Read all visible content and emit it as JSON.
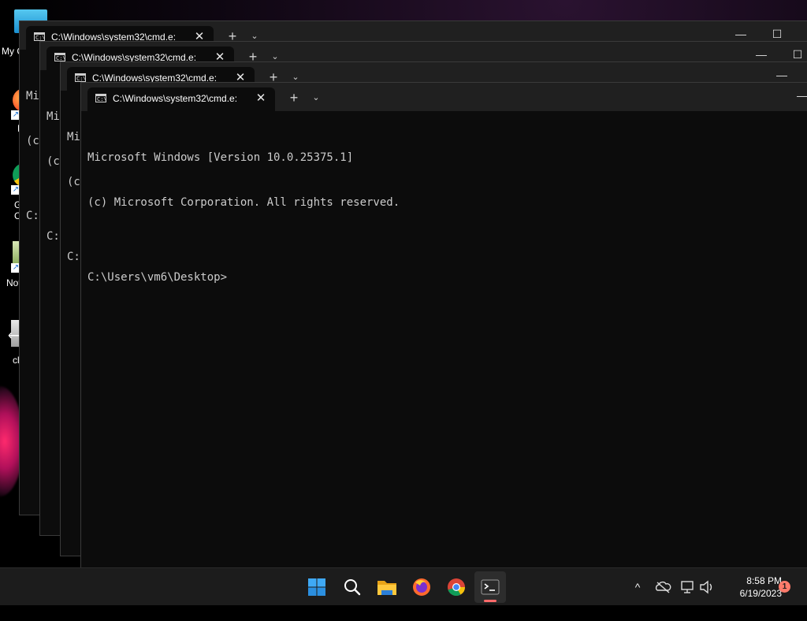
{
  "desktop": {
    "icons": [
      {
        "label": "My C"
      },
      {
        "label": "F"
      },
      {
        "label": "G"
      },
      {
        "label": "C"
      },
      {
        "label": "Not"
      },
      {
        "label": "cl"
      }
    ]
  },
  "windows": {
    "tab_title": "C:\\Windows\\system32\\cmd.e:",
    "close_glyph": "✕",
    "add_glyph": "+",
    "dropdown_glyph": "⌄",
    "minimize_glyph": "—",
    "maximize_glyph": "☐",
    "stub_lines": [
      "Mi",
      "(c",
      "",
      "C:"
    ],
    "active_lines": [
      "Microsoft Windows [Version 10.0.25375.1]",
      "(c) Microsoft Corporation. All rights reserved.",
      "",
      "C:\\Users\\vm6\\Desktop>"
    ]
  },
  "taskbar": {
    "apps": [
      {
        "name": "start",
        "icon": "windows-logo-icon"
      },
      {
        "name": "search",
        "icon": "search-icon"
      },
      {
        "name": "file-explorer",
        "icon": "folder-icon"
      },
      {
        "name": "firefox",
        "icon": "firefox-icon"
      },
      {
        "name": "chrome",
        "icon": "chrome-icon"
      },
      {
        "name": "terminal",
        "icon": "terminal-icon",
        "active": true
      }
    ],
    "tray": {
      "chevron_glyph": "^",
      "time": "8:58 PM",
      "date": "6/19/2023",
      "notification_count": "1"
    }
  },
  "colors": {
    "accent_indicator": "#ff6a6a",
    "notification_badge": "#ff7b6b"
  }
}
